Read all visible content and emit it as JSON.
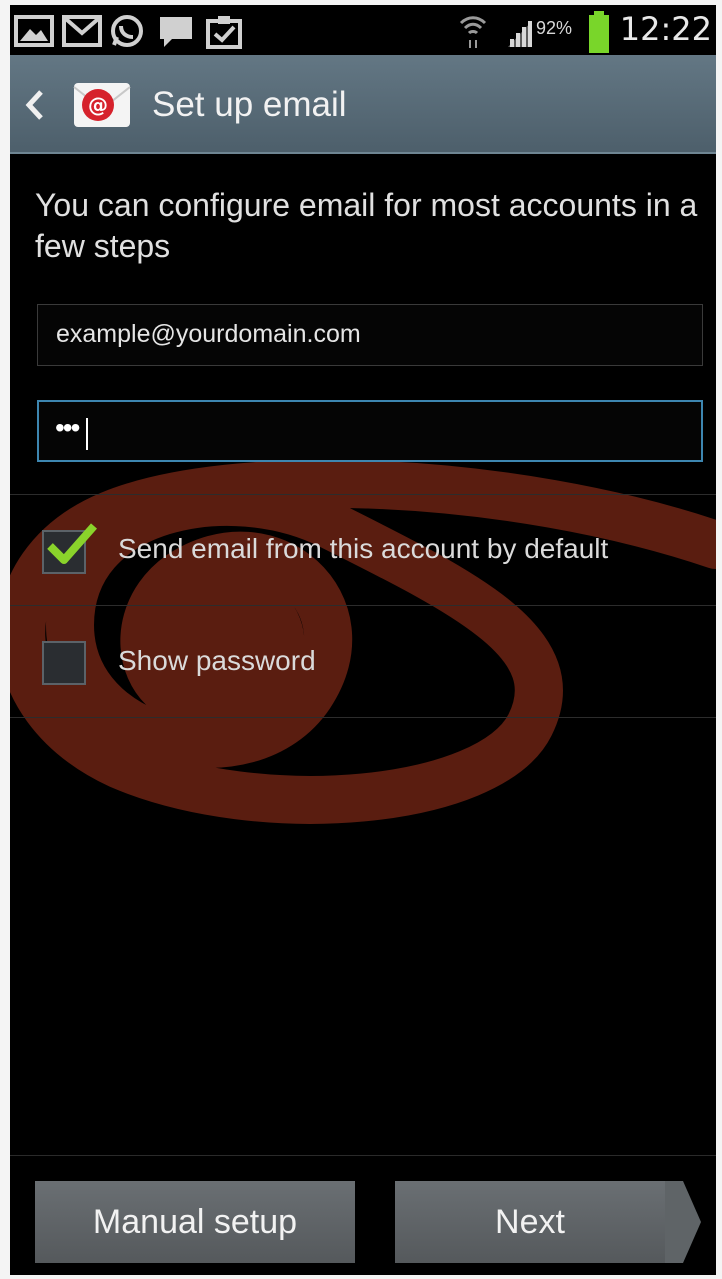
{
  "status_bar": {
    "notification_icons": [
      "gallery-icon",
      "gmail-icon",
      "whatsapp-icon",
      "message-icon",
      "clipboard-check-icon"
    ],
    "wifi_icon": "wifi-icon",
    "signal_icon": "signal-icon",
    "battery_percent": "92%",
    "battery_color": "#79d62a",
    "time": "12:22"
  },
  "action_bar": {
    "back_icon": "chevron-left-icon",
    "app_icon": "email-app-icon",
    "title": "Set up email",
    "accent_color": "#5a6d79"
  },
  "content": {
    "intro_text": "You can configure email for most accounts in a few steps",
    "email_field": {
      "value": "example@yourdomain.com"
    },
    "password_field": {
      "masked_value": "•••",
      "focused": true,
      "focus_color": "#3d86b0"
    },
    "options": [
      {
        "label": "Send email from this account by default",
        "checked": true
      },
      {
        "label": "Show password",
        "checked": false
      }
    ],
    "check_color": "#8ad32b"
  },
  "buttons": {
    "manual_setup": "Manual setup",
    "next": "Next"
  }
}
